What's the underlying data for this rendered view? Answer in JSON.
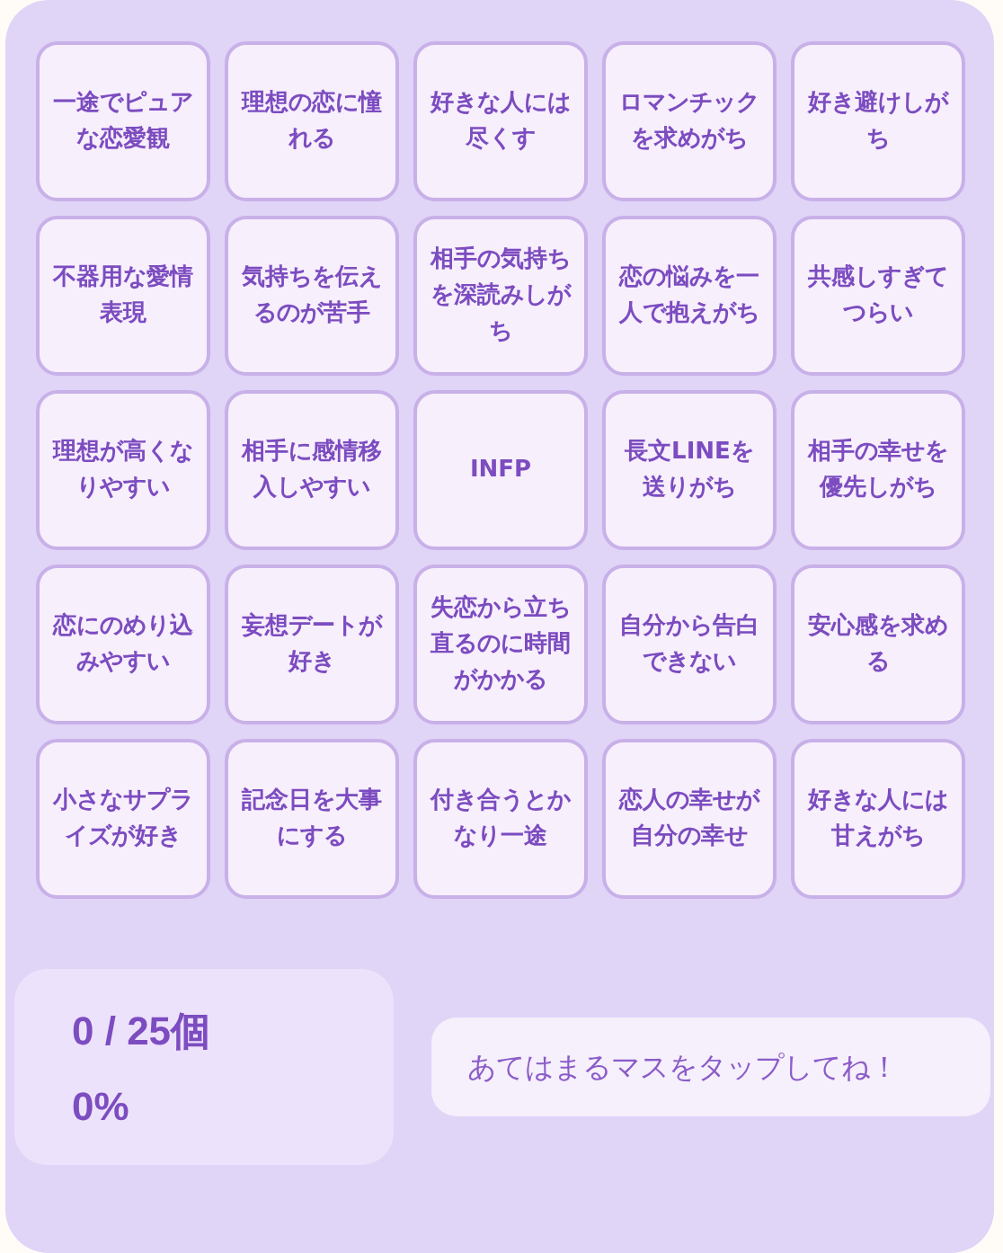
{
  "cells": [
    {
      "label": "一途でピュアな恋愛観",
      "selected": false
    },
    {
      "label": "理想の恋に憧れる",
      "selected": false
    },
    {
      "label": "好きな人には尽くす",
      "selected": false
    },
    {
      "label": "ロマンチックを求めがち",
      "selected": false
    },
    {
      "label": "好き避けしがち",
      "selected": false
    },
    {
      "label": "不器用な愛情表現",
      "selected": false
    },
    {
      "label": "気持ちを伝えるのが苦手",
      "selected": false
    },
    {
      "label": "相手の気持ちを深読みしがち",
      "selected": false
    },
    {
      "label": "恋の悩みを一人で抱えがち",
      "selected": false
    },
    {
      "label": "共感しすぎてつらい",
      "selected": false
    },
    {
      "label": "理想が高くなりやすい",
      "selected": false
    },
    {
      "label": "相手に感情移入しやすい",
      "selected": false
    },
    {
      "label": "INFP",
      "selected": false
    },
    {
      "label": "長文LINEを送りがち",
      "selected": false
    },
    {
      "label": "相手の幸せを優先しがち",
      "selected": false
    },
    {
      "label": "恋にのめり込みやすい",
      "selected": false
    },
    {
      "label": "妄想デートが好き",
      "selected": false
    },
    {
      "label": "失恋から立ち直るのに時間がかかる",
      "selected": false
    },
    {
      "label": "自分から告白できない",
      "selected": false
    },
    {
      "label": "安心感を求める",
      "selected": false
    },
    {
      "label": "小さなサプライズが好き",
      "selected": false
    },
    {
      "label": "記念日を大事にする",
      "selected": false
    },
    {
      "label": "付き合うとかなり一途",
      "selected": false
    },
    {
      "label": "恋人の幸せが自分の幸せ",
      "selected": false
    },
    {
      "label": "好きな人には甘えがち",
      "selected": false
    }
  ],
  "stats": {
    "count": "0 / 25個",
    "percent": "0%"
  },
  "message": "あてはまるマスをタップしてね！"
}
